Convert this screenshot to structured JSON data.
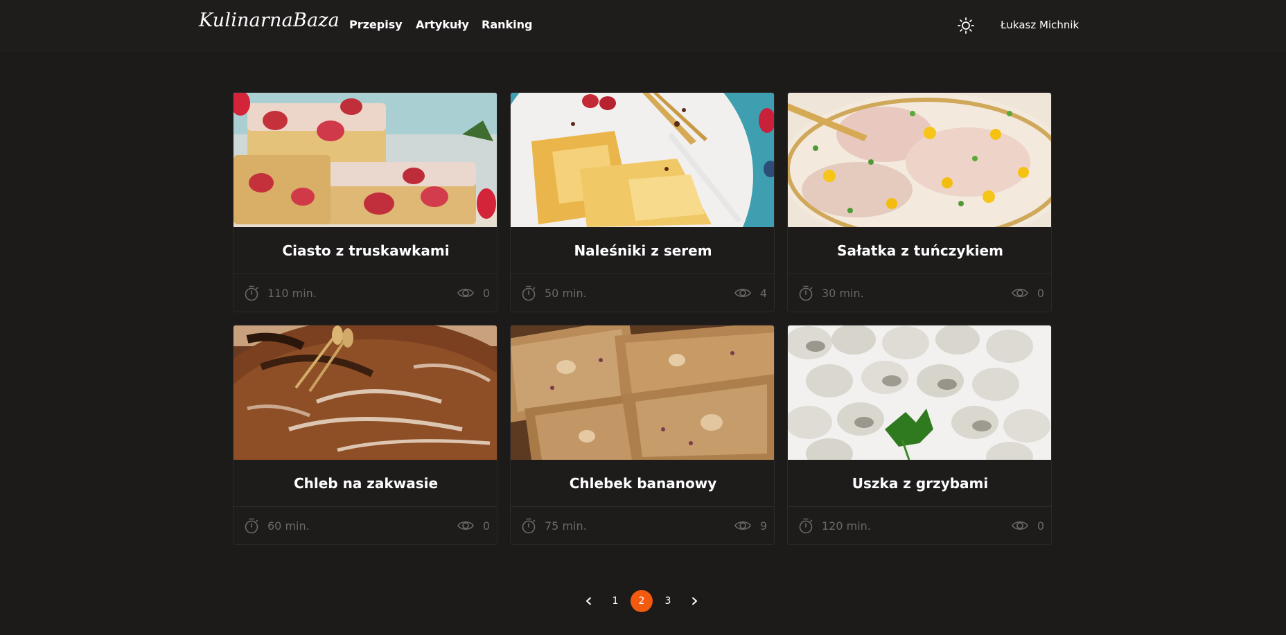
{
  "header": {
    "brand": "KulinarnaBaza",
    "nav": [
      "Przepisy",
      "Artykuły",
      "Ranking"
    ],
    "user_name": "Łukasz Michnik",
    "theme_icon": "sun-icon"
  },
  "recipes": [
    {
      "title": "Ciasto z truskawkami",
      "time": "110 min.",
      "views": "0"
    },
    {
      "title": "Naleśniki z serem",
      "time": "50 min.",
      "views": "4"
    },
    {
      "title": "Sałatka z tuńczykiem",
      "time": "30 min.",
      "views": "0"
    },
    {
      "title": "Chleb na zakwasie",
      "time": "60 min.",
      "views": "0"
    },
    {
      "title": "Chlebek bananowy",
      "time": "75 min.",
      "views": "9"
    },
    {
      "title": "Uszka z grzybami",
      "time": "120 min.",
      "views": "0"
    }
  ],
  "pagination": {
    "prev_icon": "chevron-left-icon",
    "pages": [
      "1",
      "2",
      "3"
    ],
    "current": "2",
    "next_icon": "chevron-right-icon"
  },
  "colors": {
    "background": "#1d1a1a",
    "accent": "#f25a0f",
    "muted_text": "#6c6868"
  }
}
